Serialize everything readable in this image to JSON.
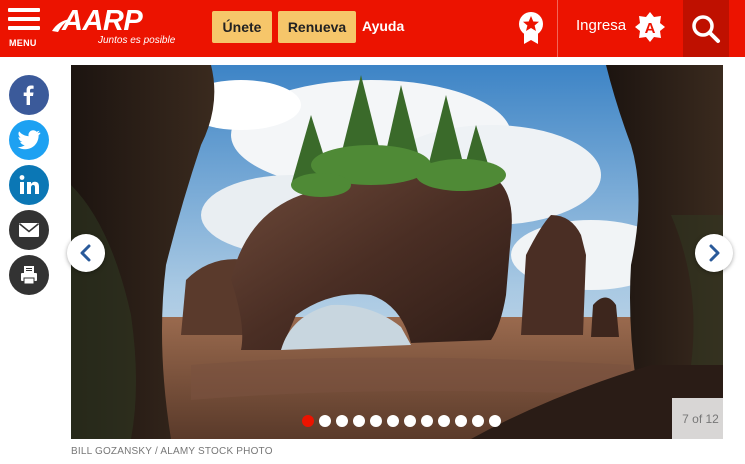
{
  "header": {
    "menu_label": "MENU",
    "logo_text": "AARP",
    "logo_tagline": "Juntos es posible",
    "join_label": "Únete",
    "renew_label": "Renueva",
    "help_label": "Ayuda",
    "signin_label": "Ingresa",
    "brand_color": "#ec1300",
    "button_color": "#f6c66a"
  },
  "social": [
    "facebook-icon",
    "twitter-icon",
    "linkedin-icon",
    "email-icon",
    "print-icon"
  ],
  "slideshow": {
    "current": 7,
    "total": 12,
    "counter_text": "7 of 12",
    "photo_credit": "BILL GOZANSKY / ALAMY STOCK PHOTO"
  }
}
